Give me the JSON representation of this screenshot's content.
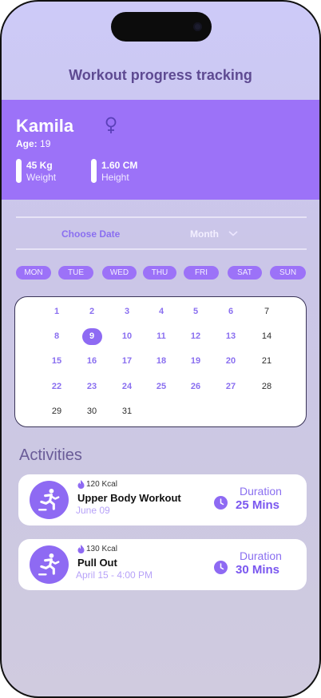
{
  "header": {
    "title": "Workout progress tracking"
  },
  "profile": {
    "name": "Kamila",
    "gender_icon": "female-symbol-icon",
    "age_label": "Age:",
    "age_value": "19",
    "weight_value": "45 Kg",
    "weight_label": "Weight",
    "height_value": "1.60 CM",
    "height_label": "Height"
  },
  "filter": {
    "choose_date_label": "Choose Date",
    "period_value": "Month",
    "period_icon": "chevron-down-icon"
  },
  "weekdays": [
    "MON",
    "TUE",
    "WED",
    "THU",
    "FRI",
    "SAT",
    "SUN"
  ],
  "calendar": {
    "selected_day": 9,
    "days": [
      "1",
      "2",
      "3",
      "4",
      "5",
      "6",
      "7",
      "8",
      "9",
      "10",
      "11",
      "12",
      "13",
      "14",
      "15",
      "16",
      "17",
      "18",
      "19",
      "20",
      "21",
      "22",
      "23",
      "24",
      "25",
      "26",
      "27",
      "28",
      "29",
      "30",
      "31"
    ]
  },
  "activities": {
    "title": "Activities",
    "items": [
      {
        "icon": "runner-icon",
        "kcal": "120 Kcal",
        "name": "Upper Body Workout",
        "date": "June 09",
        "duration_label": "Duration",
        "duration_value": "25 Mins"
      },
      {
        "icon": "runner-icon",
        "kcal": "130 Kcal",
        "name": "Pull Out",
        "date": "April 15 - 4:00 PM",
        "duration_label": "Duration",
        "duration_value": "30 Mins"
      }
    ]
  },
  "colors": {
    "accent": "#9c72f8",
    "accent_text": "#8a6ff0",
    "title": "#5e4a92"
  }
}
